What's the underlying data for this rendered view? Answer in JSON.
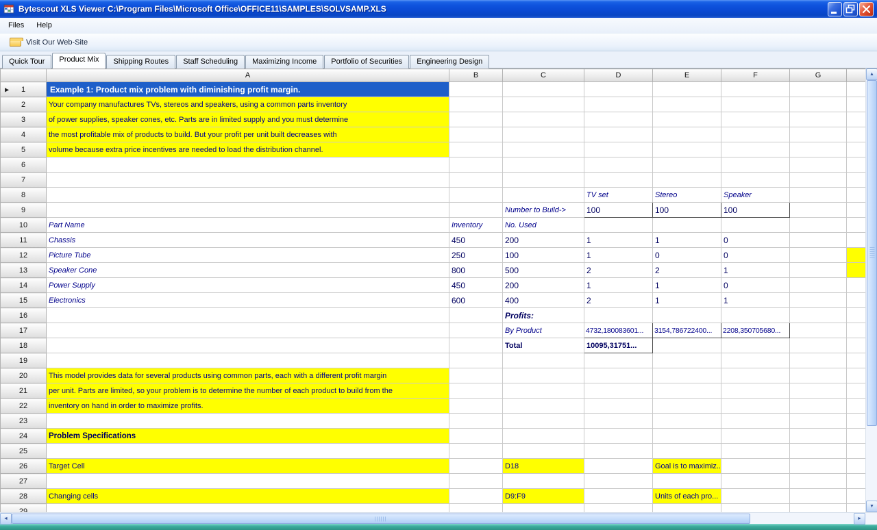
{
  "window": {
    "title": "Bytescout XLS Viewer C:\\Program Files\\Microsoft Office\\OFFICE11\\SAMPLES\\SOLVSAMP.XLS"
  },
  "menu": {
    "items": [
      "Files",
      "Help"
    ]
  },
  "toolbar": {
    "weblink": "Visit Our Web-Site"
  },
  "tabs": {
    "selected": "Product Mix",
    "items": [
      "Quick Tour",
      "Product Mix",
      "Shipping Routes",
      "Staff Scheduling",
      "Maximizing Income",
      "Portfolio of Securities",
      "Engineering Design"
    ]
  },
  "sheet": {
    "columns": [
      "A",
      "B",
      "C",
      "D",
      "E",
      "F",
      "G"
    ],
    "visible_rows": 29,
    "pointer_row": 1,
    "cells": [
      {
        "row": 1,
        "col": "A",
        "text": "Example 1:  Product mix problem with diminishing profit margin.",
        "style": "title"
      },
      {
        "row": 2,
        "col": "A",
        "text": "Your company manufactures TVs, stereos and speakers, using a common parts inventory",
        "style": "note"
      },
      {
        "row": 3,
        "col": "A",
        "text": "of power supplies, speaker cones, etc.  Parts are in limited supply and you must determine",
        "style": "note"
      },
      {
        "row": 4,
        "col": "A",
        "text": "the most profitable mix of products to build. But your profit per unit built decreases with",
        "style": "note"
      },
      {
        "row": 5,
        "col": "A",
        "text": "volume because extra price incentives are needed to load the distribution channel.",
        "style": "note"
      },
      {
        "row": 8,
        "col": "D",
        "text": "TV set",
        "style": "it"
      },
      {
        "row": 8,
        "col": "E",
        "text": "Stereo",
        "style": "it"
      },
      {
        "row": 8,
        "col": "F",
        "text": "Speaker",
        "style": "it"
      },
      {
        "row": 9,
        "col": "C",
        "text": "Number to Build->",
        "style": "it"
      },
      {
        "row": 9,
        "col": "D",
        "text": "100",
        "style": "num",
        "boxed": true
      },
      {
        "row": 9,
        "col": "E",
        "text": "100",
        "style": "num",
        "boxed": true
      },
      {
        "row": 9,
        "col": "F",
        "text": "100",
        "style": "num",
        "boxed": true
      },
      {
        "row": 10,
        "col": "A",
        "text": "Part Name",
        "style": "it"
      },
      {
        "row": 10,
        "col": "B",
        "text": "Inventory",
        "style": "it"
      },
      {
        "row": 10,
        "col": "C",
        "text": "No. Used",
        "style": "it"
      },
      {
        "row": 11,
        "col": "A",
        "text": "Chassis",
        "style": "it"
      },
      {
        "row": 11,
        "col": "B",
        "text": "450",
        "style": "num"
      },
      {
        "row": 11,
        "col": "C",
        "text": "200",
        "style": "num"
      },
      {
        "row": 11,
        "col": "D",
        "text": "1",
        "style": "num"
      },
      {
        "row": 11,
        "col": "E",
        "text": "1",
        "style": "num"
      },
      {
        "row": 11,
        "col": "F",
        "text": "0",
        "style": "num"
      },
      {
        "row": 12,
        "col": "A",
        "text": "Picture Tube",
        "style": "it"
      },
      {
        "row": 12,
        "col": "B",
        "text": "250",
        "style": "num"
      },
      {
        "row": 12,
        "col": "C",
        "text": "100",
        "style": "num"
      },
      {
        "row": 12,
        "col": "D",
        "text": "1",
        "style": "num"
      },
      {
        "row": 12,
        "col": "E",
        "text": "0",
        "style": "num"
      },
      {
        "row": 12,
        "col": "F",
        "text": "0",
        "style": "num"
      },
      {
        "row": 12,
        "col": "H",
        "text": "",
        "style": "fill"
      },
      {
        "row": 13,
        "col": "A",
        "text": "Speaker Cone",
        "style": "it"
      },
      {
        "row": 13,
        "col": "B",
        "text": "800",
        "style": "num"
      },
      {
        "row": 13,
        "col": "C",
        "text": "500",
        "style": "num"
      },
      {
        "row": 13,
        "col": "D",
        "text": "2",
        "style": "num"
      },
      {
        "row": 13,
        "col": "E",
        "text": "2",
        "style": "num"
      },
      {
        "row": 13,
        "col": "F",
        "text": "1",
        "style": "num"
      },
      {
        "row": 13,
        "col": "H",
        "text": "",
        "style": "fill"
      },
      {
        "row": 14,
        "col": "A",
        "text": "Power Supply",
        "style": "it"
      },
      {
        "row": 14,
        "col": "B",
        "text": "450",
        "style": "num"
      },
      {
        "row": 14,
        "col": "C",
        "text": "200",
        "style": "num"
      },
      {
        "row": 14,
        "col": "D",
        "text": "1",
        "style": "num"
      },
      {
        "row": 14,
        "col": "E",
        "text": "1",
        "style": "num"
      },
      {
        "row": 14,
        "col": "F",
        "text": "0",
        "style": "num"
      },
      {
        "row": 15,
        "col": "A",
        "text": "Electronics",
        "style": "it"
      },
      {
        "row": 15,
        "col": "B",
        "text": "600",
        "style": "num"
      },
      {
        "row": 15,
        "col": "C",
        "text": "400",
        "style": "num"
      },
      {
        "row": 15,
        "col": "D",
        "text": "2",
        "style": "num"
      },
      {
        "row": 15,
        "col": "E",
        "text": "1",
        "style": "num"
      },
      {
        "row": 15,
        "col": "F",
        "text": "1",
        "style": "num"
      },
      {
        "row": 16,
        "col": "C",
        "text": "Profits:",
        "style": "bi"
      },
      {
        "row": 17,
        "col": "C",
        "text": "By Product",
        "style": "it"
      },
      {
        "row": 17,
        "col": "D",
        "text": "4732,180083601...",
        "style": "numsm",
        "boxed": true
      },
      {
        "row": 17,
        "col": "E",
        "text": "3154,786722400...",
        "style": "numsm",
        "boxed": true
      },
      {
        "row": 17,
        "col": "F",
        "text": "2208,350705680...",
        "style": "numsm",
        "boxed": true
      },
      {
        "row": 18,
        "col": "C",
        "text": "Total",
        "style": "bold"
      },
      {
        "row": 18,
        "col": "D",
        "text": "10095,31751...",
        "style": "bold",
        "boxed": true
      },
      {
        "row": 20,
        "col": "A",
        "text": "This model provides data for several products using common parts, each with a different profit margin",
        "style": "note"
      },
      {
        "row": 21,
        "col": "A",
        "text": "per unit.  Parts are limited, so your problem is to determine the number of each product to build from the",
        "style": "note"
      },
      {
        "row": 22,
        "col": "A",
        "text": "inventory on hand in order to maximize profits.",
        "style": "note"
      },
      {
        "row": 24,
        "col": "A",
        "text": "Problem Specifications",
        "style": "notehead"
      },
      {
        "row": 26,
        "col": "A",
        "text": "Target Cell",
        "style": "spec"
      },
      {
        "row": 26,
        "col": "C",
        "text": "D18",
        "style": "spec"
      },
      {
        "row": 26,
        "col": "E",
        "text": "Goal is to maximiz...",
        "style": "spec"
      },
      {
        "row": 28,
        "col": "A",
        "text": "Changing cells",
        "style": "spec"
      },
      {
        "row": 28,
        "col": "C",
        "text": "D9:F9",
        "style": "spec"
      },
      {
        "row": 28,
        "col": "E",
        "text": "Units of each pro...",
        "style": "spec"
      }
    ]
  },
  "colors": {
    "titlebar_blue": "#0F53DD",
    "example_header_blue": "#1E5FC9",
    "highlight_yellow": "#FFFF00",
    "cell_text_navy": "#000080",
    "desktop_teal": "#35A195"
  }
}
